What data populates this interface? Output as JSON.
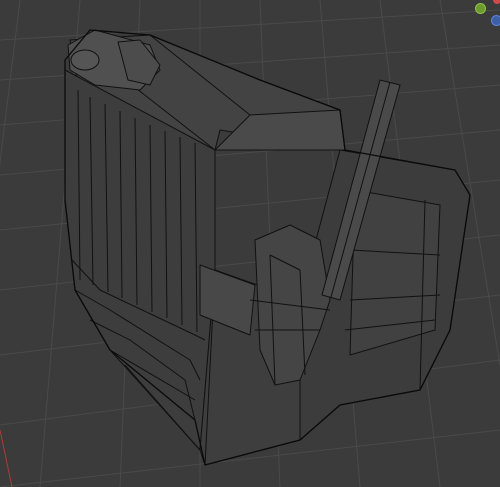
{
  "viewport": {
    "background_color": "#3b3b3b",
    "grid_color": "#4a4a4a",
    "mesh_edge_color": "#111111",
    "mesh_face_color": "#3f3f3f",
    "axis_x_color": "#b03a3a"
  },
  "gizmo": {
    "y_axis_color": "#6b9b2e",
    "z_axis_color": "#3d5fa8",
    "x_axis_color": "#d04a4a"
  },
  "object": {
    "shading": "wireframe-overlay",
    "description_icon": "retro-tv-mesh-icon"
  }
}
